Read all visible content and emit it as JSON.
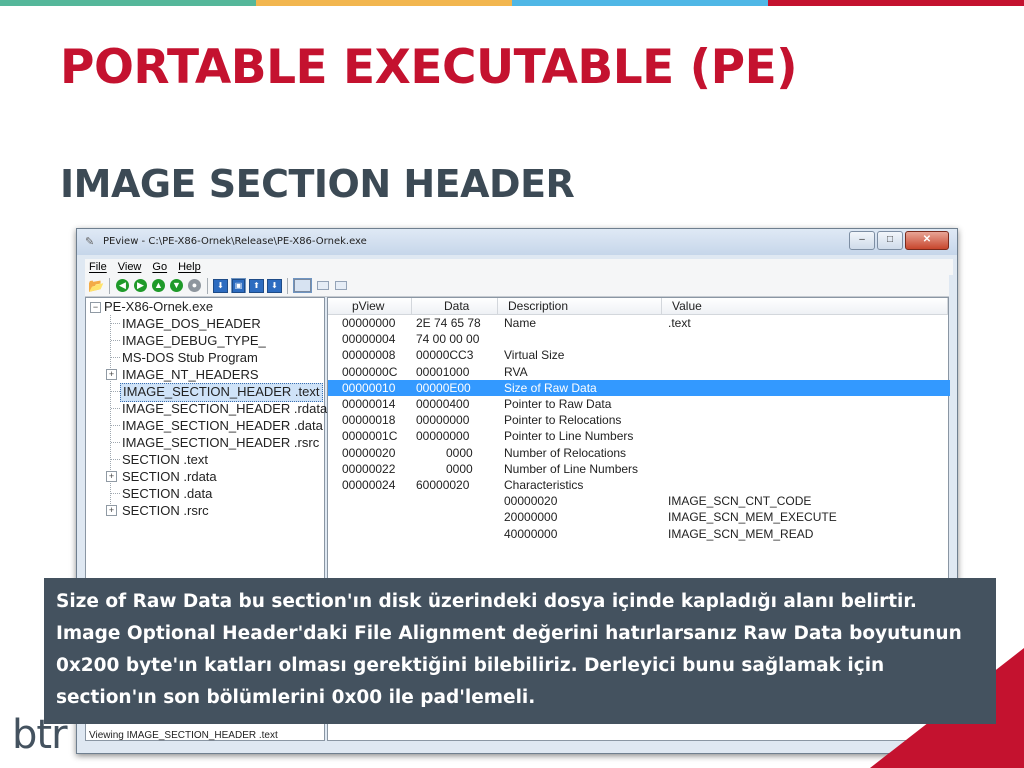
{
  "colors": {
    "title": "#c4122f",
    "subtitle": "#3c4a55",
    "caption_bg": "#44525f",
    "selection": "#3399ff",
    "top_stripes": [
      "#55b79a",
      "#f2b64f",
      "#4fb7e6",
      "#c4122f"
    ]
  },
  "slide": {
    "title": "PORTABLE EXECUTABLE (PE)",
    "subtitle": "IMAGE SECTION HEADER",
    "caption": "Size of Raw Data bu section'ın disk üzerindeki dosya içinde kapladığı alanı belirtir. Image Optional Header'daki File Alignment değerini hatırlarsanız Raw Data boyutunun 0x200 byte'ın katları olması gerektiğini bilebiliriz. Derleyici bunu sağlamak için section'ın son bölümlerini 0x00 ile pad'lemeli."
  },
  "window": {
    "title": "PEview - C:\\PE-X86-Ornek\\Release\\PE-X86-Ornek.exe",
    "menu": [
      "File",
      "View",
      "Go",
      "Help"
    ],
    "toolbar_icons": [
      "open-icon",
      "back-icon",
      "forward-icon",
      "up-icon",
      "down-icon",
      "go-icon",
      "save-icon",
      "view-icon",
      "export-icon",
      "import-icon",
      "hex-view-icon",
      "list-view-icon",
      "detail-view-icon"
    ],
    "status": "Viewing IMAGE_SECTION_HEADER .text"
  },
  "tree": {
    "root": "PE-X86-Ornek.exe",
    "items": [
      {
        "label": "IMAGE_DOS_HEADER"
      },
      {
        "label": "IMAGE_DEBUG_TYPE_"
      },
      {
        "label": "MS-DOS Stub Program"
      },
      {
        "label": "IMAGE_NT_HEADERS",
        "expandable": true
      },
      {
        "label": "IMAGE_SECTION_HEADER .text",
        "selected": true
      },
      {
        "label": "IMAGE_SECTION_HEADER .rdata"
      },
      {
        "label": "IMAGE_SECTION_HEADER .data"
      },
      {
        "label": "IMAGE_SECTION_HEADER .rsrc"
      },
      {
        "label": "SECTION .text"
      },
      {
        "label": "SECTION .rdata",
        "expandable": true
      },
      {
        "label": "SECTION .data"
      },
      {
        "label": "SECTION .rsrc",
        "expandable": true
      }
    ]
  },
  "grid": {
    "columns": [
      "pView",
      "Data",
      "Description",
      "Value"
    ],
    "rows": [
      {
        "pview": "00000000",
        "data": "2E  74  65  78",
        "desc": "Name",
        "value": ".text"
      },
      {
        "pview": "00000004",
        "data": "74  00  00  00",
        "desc": "",
        "value": ""
      },
      {
        "pview": "00000008",
        "data": "00000CC3",
        "desc": "Virtual Size",
        "value": ""
      },
      {
        "pview": "0000000C",
        "data": "00001000",
        "desc": "RVA",
        "value": ""
      },
      {
        "pview": "00000010",
        "data": "00000E00",
        "desc": "Size of Raw Data",
        "value": "",
        "selected": true
      },
      {
        "pview": "00000014",
        "data": "00000400",
        "desc": "Pointer to Raw Data",
        "value": ""
      },
      {
        "pview": "00000018",
        "data": "00000000",
        "desc": "Pointer to Relocations",
        "value": ""
      },
      {
        "pview": "0000001C",
        "data": "00000000",
        "desc": "Pointer to Line Numbers",
        "value": ""
      },
      {
        "pview": "00000020",
        "data": "0000",
        "desc": "Number of Relocations",
        "value": ""
      },
      {
        "pview": "00000022",
        "data": "0000",
        "desc": "Number of Line Numbers",
        "value": ""
      },
      {
        "pview": "00000024",
        "data": "60000020",
        "desc": "Characteristics",
        "value": ""
      },
      {
        "pview": "",
        "data": "",
        "desc": "00000020",
        "value": "IMAGE_SCN_CNT_CODE"
      },
      {
        "pview": "",
        "data": "",
        "desc": "20000000",
        "value": "IMAGE_SCN_MEM_EXECUTE"
      },
      {
        "pview": "",
        "data": "",
        "desc": "40000000",
        "value": "IMAGE_SCN_MEM_READ"
      }
    ]
  },
  "logo": {
    "text": "btr"
  }
}
